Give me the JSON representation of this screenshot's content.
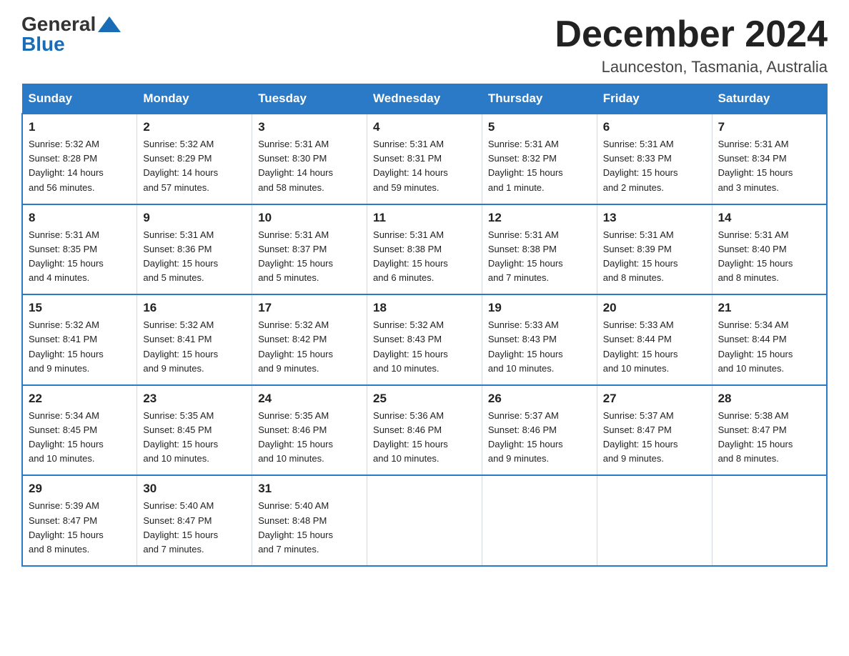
{
  "logo": {
    "general": "General",
    "blue": "Blue",
    "arrow": "▶"
  },
  "title": "December 2024",
  "location": "Launceston, Tasmania, Australia",
  "days_header": [
    "Sunday",
    "Monday",
    "Tuesday",
    "Wednesday",
    "Thursday",
    "Friday",
    "Saturday"
  ],
  "weeks": [
    [
      {
        "num": "1",
        "info": "Sunrise: 5:32 AM\nSunset: 8:28 PM\nDaylight: 14 hours\nand 56 minutes."
      },
      {
        "num": "2",
        "info": "Sunrise: 5:32 AM\nSunset: 8:29 PM\nDaylight: 14 hours\nand 57 minutes."
      },
      {
        "num": "3",
        "info": "Sunrise: 5:31 AM\nSunset: 8:30 PM\nDaylight: 14 hours\nand 58 minutes."
      },
      {
        "num": "4",
        "info": "Sunrise: 5:31 AM\nSunset: 8:31 PM\nDaylight: 14 hours\nand 59 minutes."
      },
      {
        "num": "5",
        "info": "Sunrise: 5:31 AM\nSunset: 8:32 PM\nDaylight: 15 hours\nand 1 minute."
      },
      {
        "num": "6",
        "info": "Sunrise: 5:31 AM\nSunset: 8:33 PM\nDaylight: 15 hours\nand 2 minutes."
      },
      {
        "num": "7",
        "info": "Sunrise: 5:31 AM\nSunset: 8:34 PM\nDaylight: 15 hours\nand 3 minutes."
      }
    ],
    [
      {
        "num": "8",
        "info": "Sunrise: 5:31 AM\nSunset: 8:35 PM\nDaylight: 15 hours\nand 4 minutes."
      },
      {
        "num": "9",
        "info": "Sunrise: 5:31 AM\nSunset: 8:36 PM\nDaylight: 15 hours\nand 5 minutes."
      },
      {
        "num": "10",
        "info": "Sunrise: 5:31 AM\nSunset: 8:37 PM\nDaylight: 15 hours\nand 5 minutes."
      },
      {
        "num": "11",
        "info": "Sunrise: 5:31 AM\nSunset: 8:38 PM\nDaylight: 15 hours\nand 6 minutes."
      },
      {
        "num": "12",
        "info": "Sunrise: 5:31 AM\nSunset: 8:38 PM\nDaylight: 15 hours\nand 7 minutes."
      },
      {
        "num": "13",
        "info": "Sunrise: 5:31 AM\nSunset: 8:39 PM\nDaylight: 15 hours\nand 8 minutes."
      },
      {
        "num": "14",
        "info": "Sunrise: 5:31 AM\nSunset: 8:40 PM\nDaylight: 15 hours\nand 8 minutes."
      }
    ],
    [
      {
        "num": "15",
        "info": "Sunrise: 5:32 AM\nSunset: 8:41 PM\nDaylight: 15 hours\nand 9 minutes."
      },
      {
        "num": "16",
        "info": "Sunrise: 5:32 AM\nSunset: 8:41 PM\nDaylight: 15 hours\nand 9 minutes."
      },
      {
        "num": "17",
        "info": "Sunrise: 5:32 AM\nSunset: 8:42 PM\nDaylight: 15 hours\nand 9 minutes."
      },
      {
        "num": "18",
        "info": "Sunrise: 5:32 AM\nSunset: 8:43 PM\nDaylight: 15 hours\nand 10 minutes."
      },
      {
        "num": "19",
        "info": "Sunrise: 5:33 AM\nSunset: 8:43 PM\nDaylight: 15 hours\nand 10 minutes."
      },
      {
        "num": "20",
        "info": "Sunrise: 5:33 AM\nSunset: 8:44 PM\nDaylight: 15 hours\nand 10 minutes."
      },
      {
        "num": "21",
        "info": "Sunrise: 5:34 AM\nSunset: 8:44 PM\nDaylight: 15 hours\nand 10 minutes."
      }
    ],
    [
      {
        "num": "22",
        "info": "Sunrise: 5:34 AM\nSunset: 8:45 PM\nDaylight: 15 hours\nand 10 minutes."
      },
      {
        "num": "23",
        "info": "Sunrise: 5:35 AM\nSunset: 8:45 PM\nDaylight: 15 hours\nand 10 minutes."
      },
      {
        "num": "24",
        "info": "Sunrise: 5:35 AM\nSunset: 8:46 PM\nDaylight: 15 hours\nand 10 minutes."
      },
      {
        "num": "25",
        "info": "Sunrise: 5:36 AM\nSunset: 8:46 PM\nDaylight: 15 hours\nand 10 minutes."
      },
      {
        "num": "26",
        "info": "Sunrise: 5:37 AM\nSunset: 8:46 PM\nDaylight: 15 hours\nand 9 minutes."
      },
      {
        "num": "27",
        "info": "Sunrise: 5:37 AM\nSunset: 8:47 PM\nDaylight: 15 hours\nand 9 minutes."
      },
      {
        "num": "28",
        "info": "Sunrise: 5:38 AM\nSunset: 8:47 PM\nDaylight: 15 hours\nand 8 minutes."
      }
    ],
    [
      {
        "num": "29",
        "info": "Sunrise: 5:39 AM\nSunset: 8:47 PM\nDaylight: 15 hours\nand 8 minutes."
      },
      {
        "num": "30",
        "info": "Sunrise: 5:40 AM\nSunset: 8:47 PM\nDaylight: 15 hours\nand 7 minutes."
      },
      {
        "num": "31",
        "info": "Sunrise: 5:40 AM\nSunset: 8:48 PM\nDaylight: 15 hours\nand 7 minutes."
      },
      null,
      null,
      null,
      null
    ]
  ]
}
